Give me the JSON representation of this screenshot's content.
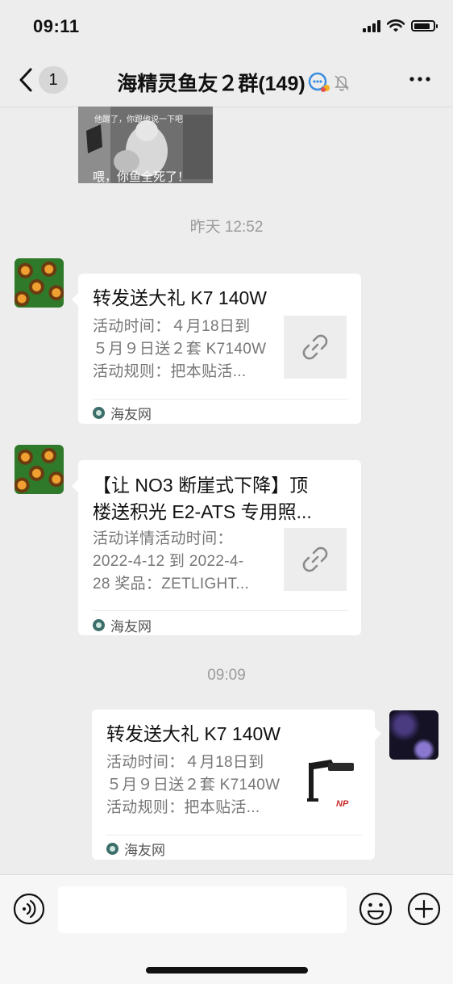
{
  "status": {
    "time": "09:11"
  },
  "nav": {
    "unread_count": "1",
    "title": "海精灵鱼友２群(149)"
  },
  "photo": {
    "caption_top": "他醒了，你跟他说一下吧",
    "caption_bottom": "喂，你鱼全死了！"
  },
  "messages": [
    {
      "timestamp": "昨天 12:52",
      "title": "转发送大礼  K7 140W",
      "desc_lines": [
        "活动时间：４月18日到",
        "５月９日送２套 K7140W",
        "活动规则：把本贴活..."
      ],
      "source": "海友网"
    },
    {
      "title_lines": [
        "【让 NO3 断崖式下降】顶",
        "楼送积光 E2-ATS 专用照..."
      ],
      "desc_lines": [
        "活动详情活动时间：",
        "2022-4-12 到 2022-4-",
        "28 奖品：ZETLIGHT..."
      ],
      "source": "海友网"
    },
    {
      "timestamp": "09:09",
      "title": "转发送大礼  K7 140W",
      "desc_lines": [
        "活动时间：４月18日到",
        "５月９日送２套 K7140W",
        "活动规则：把本贴活..."
      ],
      "source": "海友网",
      "thumb_brand": "NP"
    }
  ],
  "colors": {
    "background": "#ededed",
    "card": "#ffffff",
    "muted": "#777777"
  }
}
